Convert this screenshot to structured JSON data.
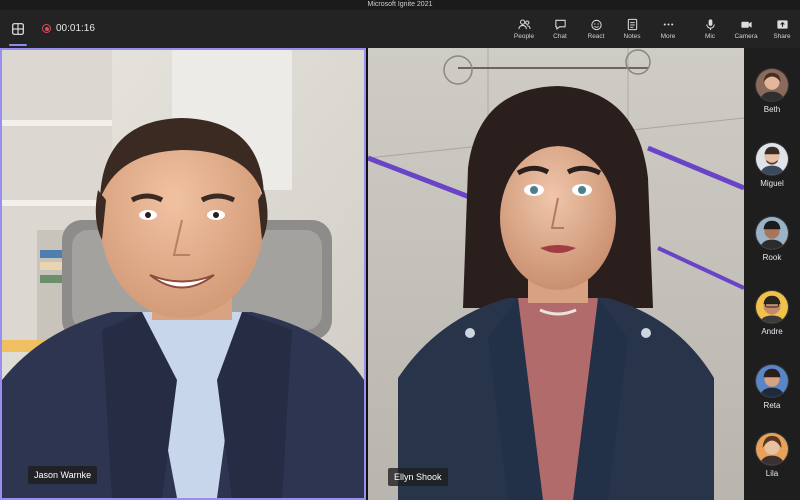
{
  "window": {
    "title": "Microsoft Ignite 2021"
  },
  "toolbar": {
    "recording_time": "00:01:16",
    "items": [
      {
        "label": "People",
        "icon": "people-icon"
      },
      {
        "label": "Chat",
        "icon": "chat-icon"
      },
      {
        "label": "React",
        "icon": "react-icon"
      },
      {
        "label": "Notes",
        "icon": "notes-icon"
      },
      {
        "label": "More",
        "icon": "more-icon"
      },
      {
        "label": "Mic",
        "icon": "mic-icon"
      },
      {
        "label": "Camera",
        "icon": "camera-icon"
      },
      {
        "label": "Share",
        "icon": "share-icon"
      }
    ]
  },
  "tiles": [
    {
      "name": "Jason Warnke"
    },
    {
      "name": "Ellyn Shook"
    }
  ],
  "roster": [
    {
      "name": "Beth"
    },
    {
      "name": "Miguel"
    },
    {
      "name": "Rook"
    },
    {
      "name": "Andre"
    },
    {
      "name": "Reta"
    },
    {
      "name": "Lila"
    }
  ],
  "colors": {
    "accent": "#9b8ef2",
    "record": "#e04a5a",
    "toolbar": "#232323"
  }
}
